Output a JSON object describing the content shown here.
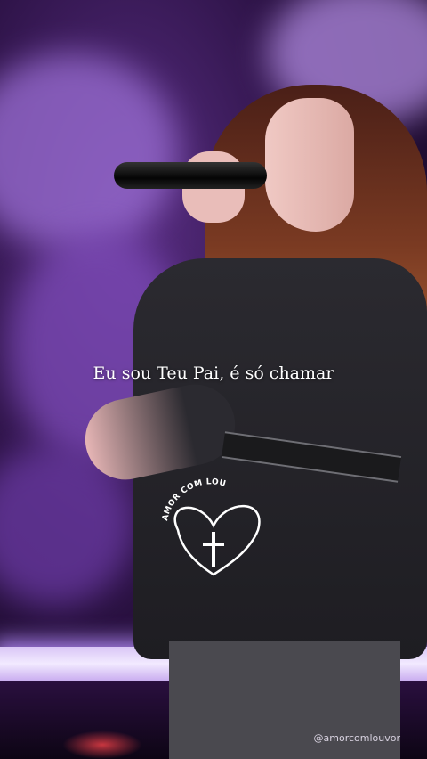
{
  "video": {
    "subtitle": "Eu sou Teu Pai, é só chamar",
    "watermark": "@amorcomlouvor"
  },
  "logo": {
    "text": "AMOR COM LOUVOR",
    "icon": "heart-with-cross-icon"
  },
  "colors": {
    "stage_purple": "#5b2f86",
    "light_strip": "#f2eaff",
    "text": "#ffffff"
  }
}
